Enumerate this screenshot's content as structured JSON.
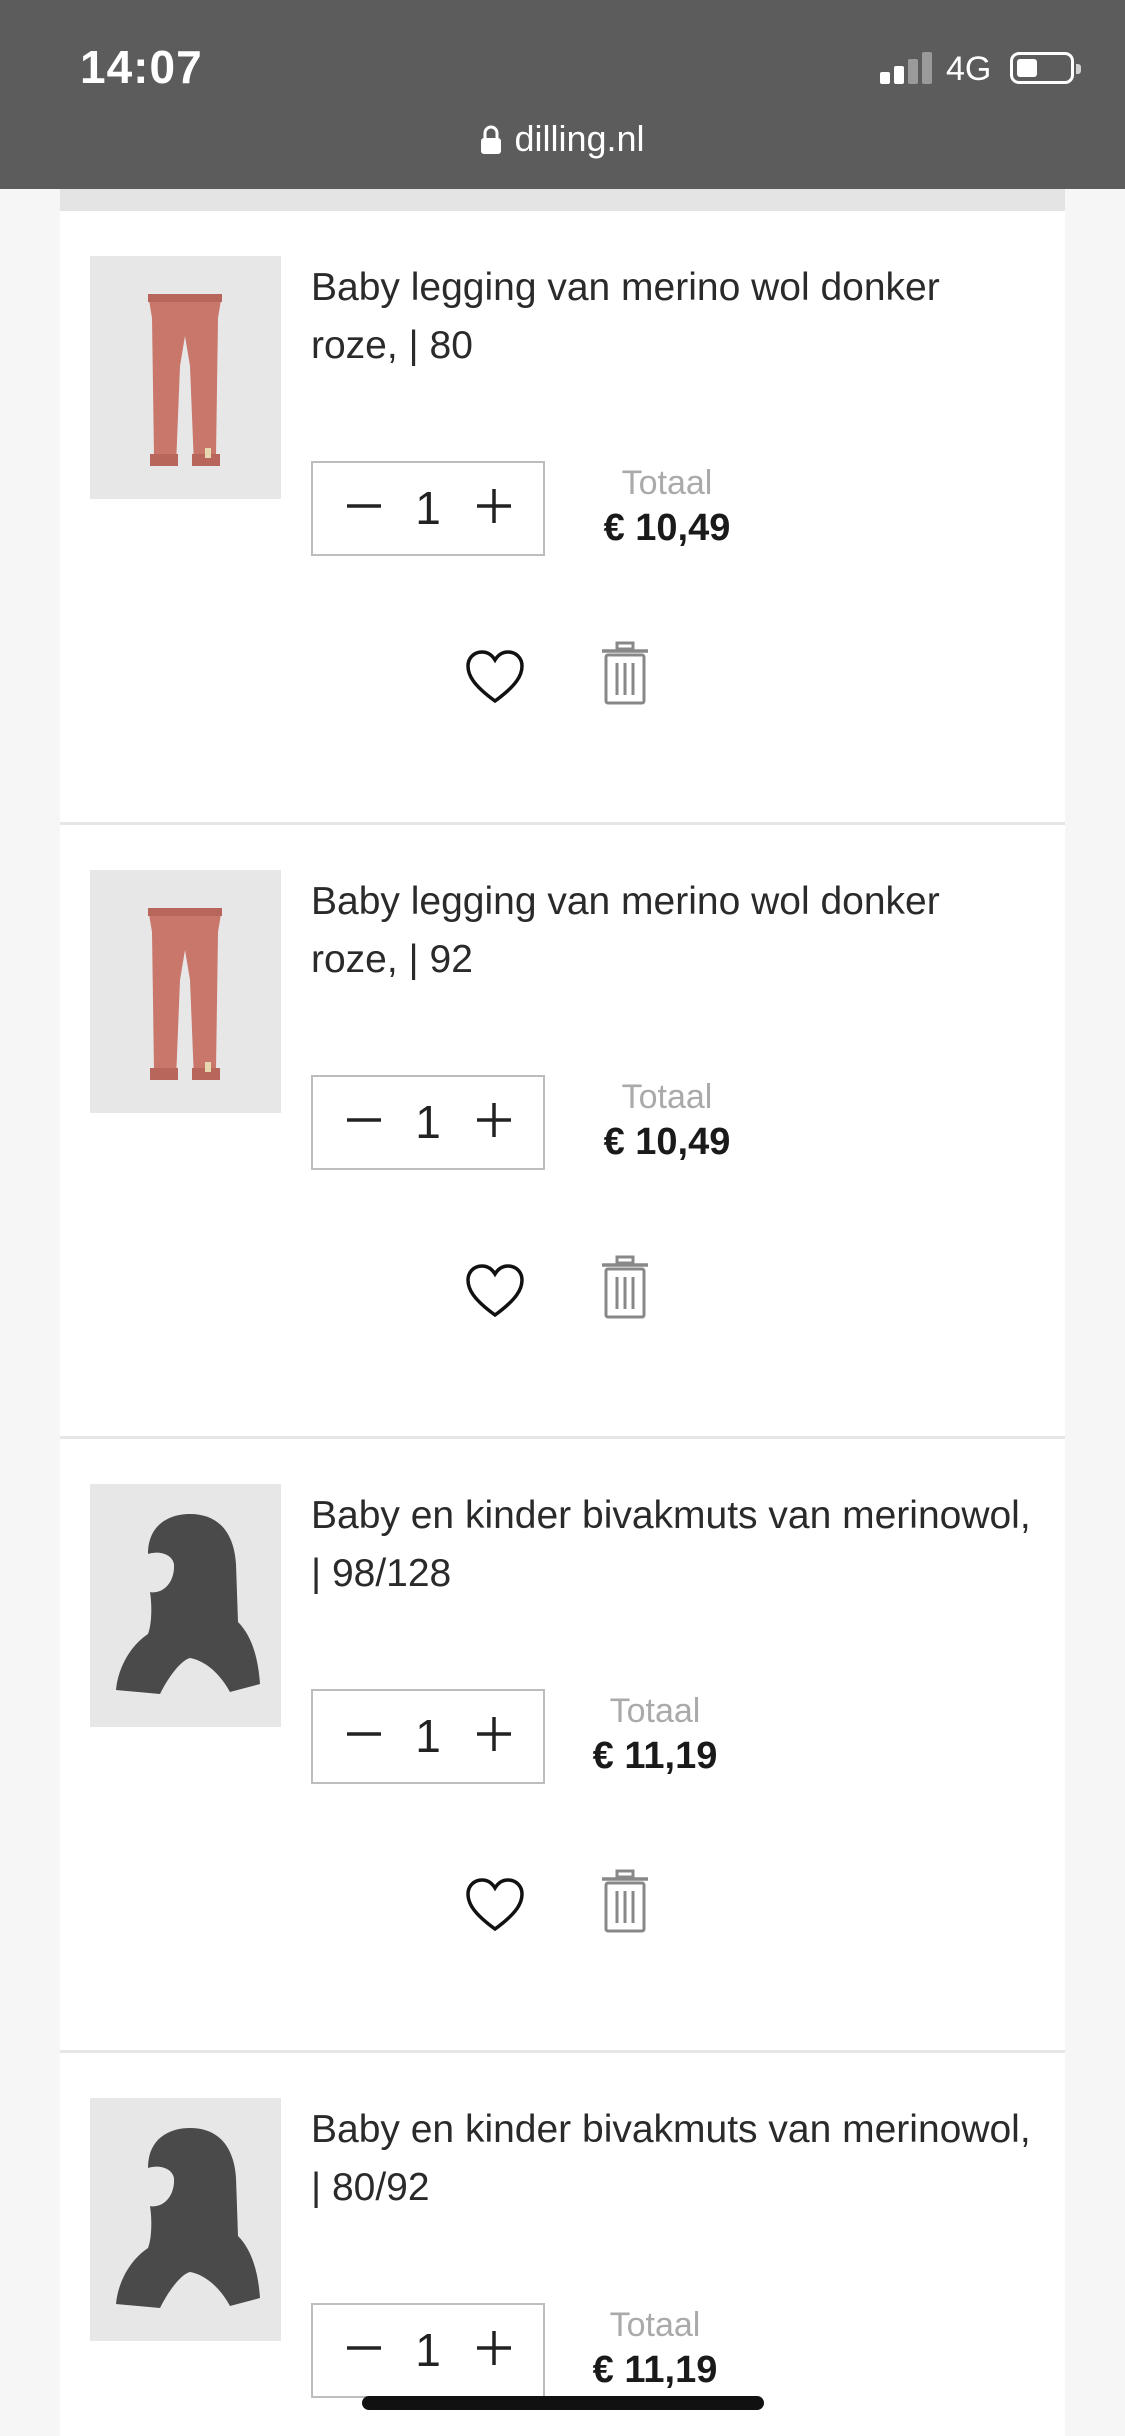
{
  "status_bar": {
    "time": "14:07",
    "network": "4G",
    "signal_bars_active": 2,
    "battery_level": 0.3
  },
  "browser": {
    "url": "dilling.nl",
    "icon": "lock-icon"
  },
  "cart": {
    "items": [
      {
        "title": "Baby legging van merino wol donker roze, | 80",
        "quantity": "1",
        "total_label": "Totaal",
        "total_price": "€ 10,49",
        "image": "pink-leggings",
        "image_color": "#c9766b"
      },
      {
        "title": "Baby legging van merino wol donker roze, | 92",
        "quantity": "1",
        "total_label": "Totaal",
        "total_price": "€ 10,49",
        "image": "pink-leggings",
        "image_color": "#c9766b"
      },
      {
        "title": "Baby en kinder bivakmuts van merinowol, | 98/128",
        "quantity": "1",
        "total_label": "Totaal",
        "total_price": "€ 11,19",
        "image": "grey-balaclava",
        "image_color": "#4a4a4a"
      },
      {
        "title": "Baby en kinder bivakmuts van merinowol, | 80/92",
        "quantity": "1",
        "total_label": "Totaal",
        "total_price": "€ 11,19",
        "image": "grey-balaclava",
        "image_color": "#4a4a4a"
      }
    ]
  },
  "icons": {
    "decrease": "minus-icon",
    "increase": "plus-icon",
    "favorite": "heart-icon",
    "remove": "trash-icon"
  },
  "colors": {
    "top_bar": "#5c5c5c",
    "page_background": "#f6f6f6",
    "card_background": "#ffffff",
    "total_label": "#aaaaaa"
  }
}
